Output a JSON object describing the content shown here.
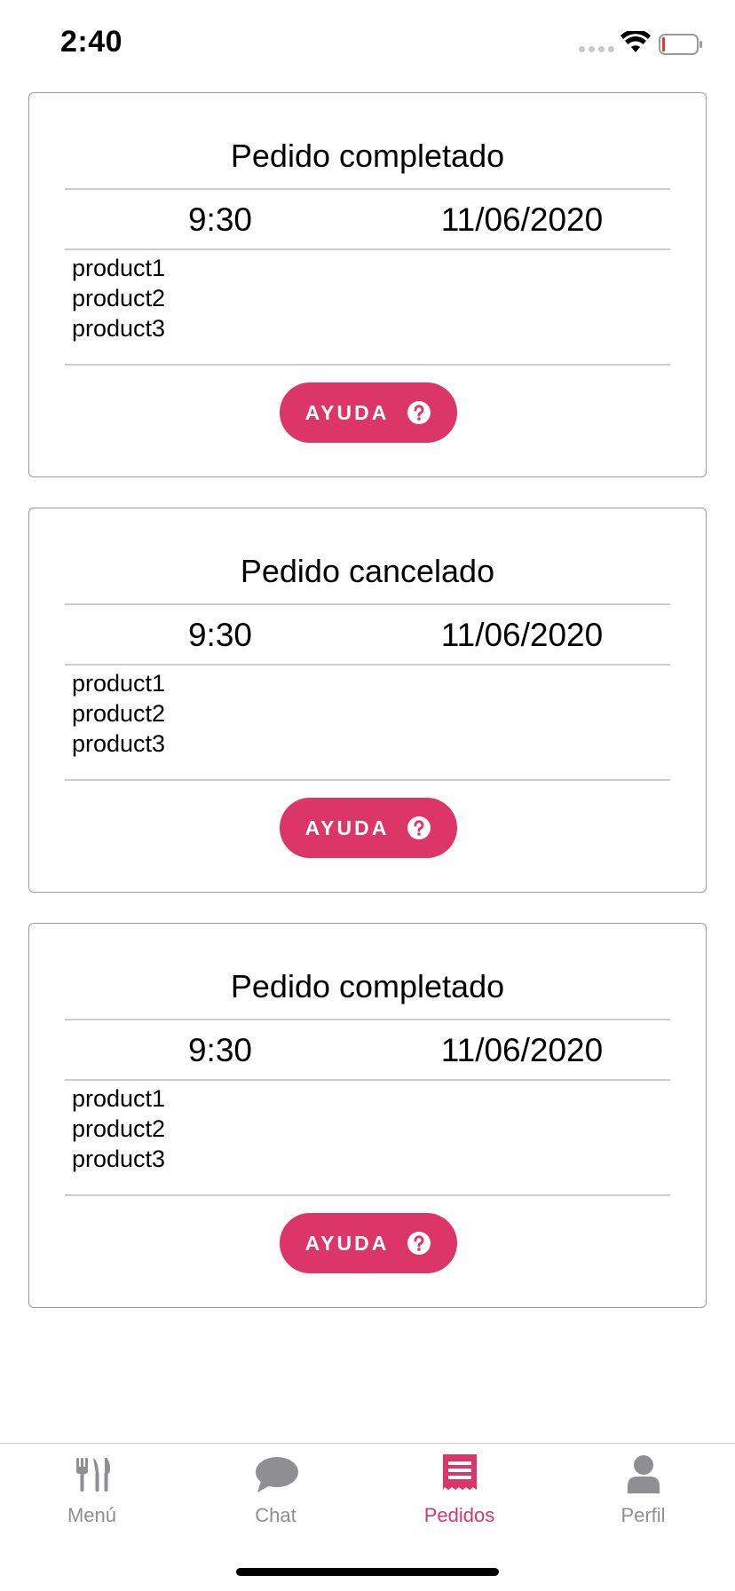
{
  "status_bar": {
    "time": "2:40"
  },
  "colors": {
    "accent": "#db3667",
    "tab_inactive": "#8e8e93",
    "card_border": "#9a9a9a"
  },
  "orders": [
    {
      "status": "Pedido completado",
      "time": "9:30",
      "date": "11/06/2020",
      "products": [
        "product1",
        "product2",
        "product3"
      ],
      "help_label": "AYUDA",
      "help_icon": "question-circle-icon"
    },
    {
      "status": "Pedido cancelado",
      "time": "9:30",
      "date": "11/06/2020",
      "products": [
        "product1",
        "product2",
        "product3"
      ],
      "help_label": "AYUDA",
      "help_icon": "question-circle-icon"
    },
    {
      "status": "Pedido completado",
      "time": "9:30",
      "date": "11/06/2020",
      "products": [
        "product1",
        "product2",
        "product3"
      ],
      "help_label": "AYUDA",
      "help_icon": "question-circle-icon"
    }
  ],
  "tab_bar": {
    "active": "Pedidos",
    "items": [
      {
        "label": "Menú",
        "icon": "fork-knife-icon"
      },
      {
        "label": "Chat",
        "icon": "chat-bubble-icon"
      },
      {
        "label": "Pedidos",
        "icon": "receipt-icon"
      },
      {
        "label": "Perfil",
        "icon": "person-icon"
      }
    ]
  }
}
